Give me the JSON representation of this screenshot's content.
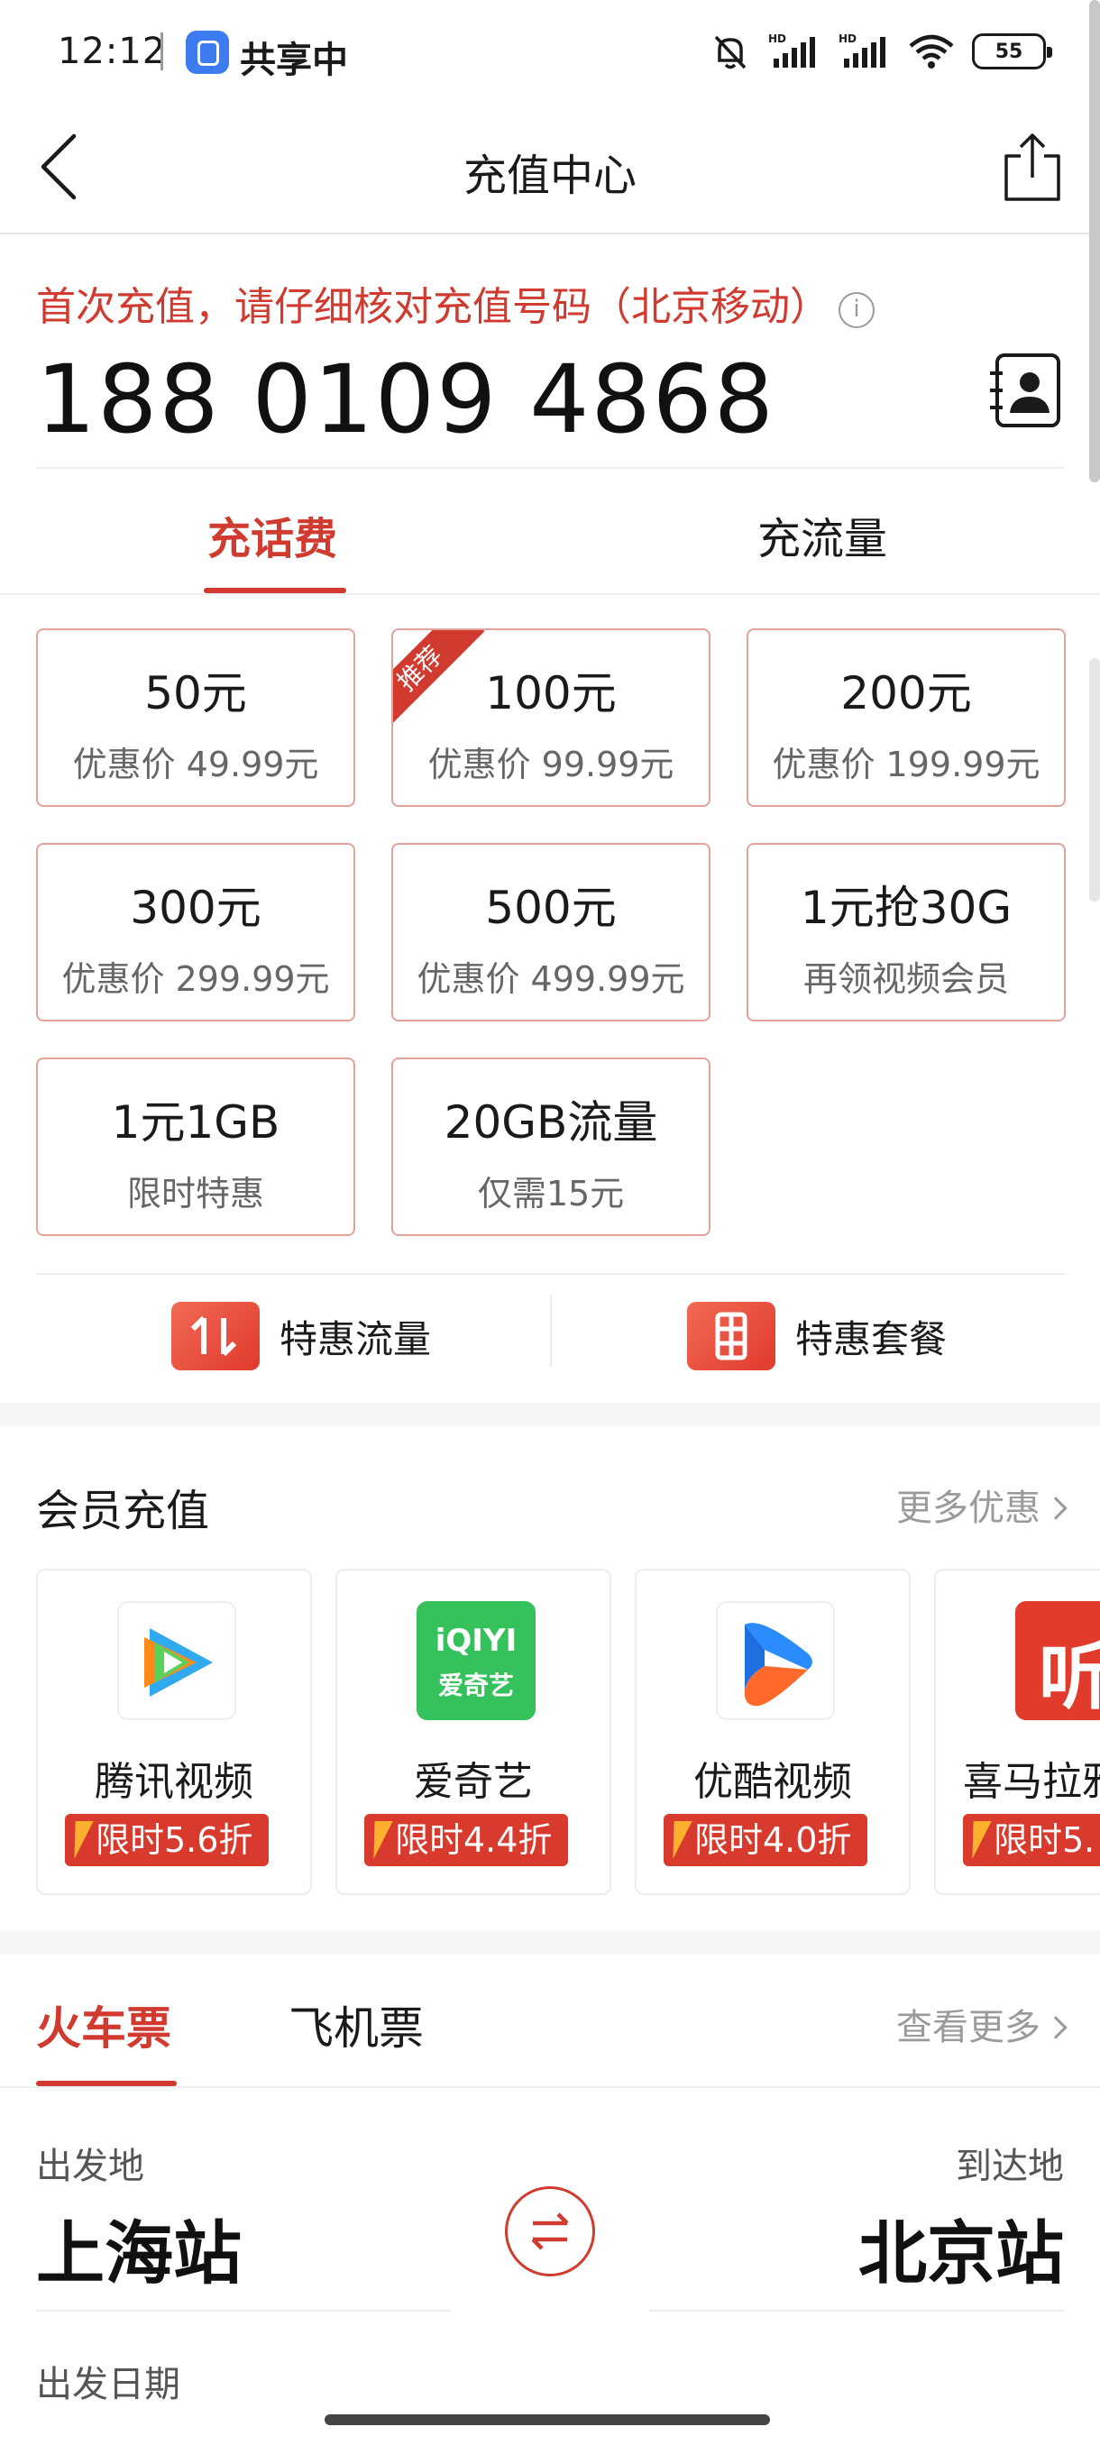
{
  "status_bar": {
    "time": "12:12",
    "share_text": "共享中",
    "battery": "55",
    "hd_label": "HD"
  },
  "nav": {
    "title": "充值中心"
  },
  "phone": {
    "notice": "首次充值，请仔细核对充值号码（北京移动）",
    "number": "188 0109 4868"
  },
  "tabs": {
    "active": "充话费",
    "inactive": "充流量"
  },
  "recharge_options": [
    {
      "main": "50元",
      "sub": "优惠价 49.99元"
    },
    {
      "main": "100元",
      "sub": "优惠价 99.99元",
      "tag": "推荐"
    },
    {
      "main": "200元",
      "sub": "优惠价 199.99元"
    },
    {
      "main": "300元",
      "sub": "优惠价 299.99元"
    },
    {
      "main": "500元",
      "sub": "优惠价 499.99元"
    },
    {
      "main": "1元抢30G",
      "sub": "再领视频会员"
    },
    {
      "main": "1元1GB",
      "sub": "限时特惠"
    },
    {
      "main": "20GB流量",
      "sub": "仅需15元"
    }
  ],
  "specials": {
    "flow": "特惠流量",
    "package": "特惠套餐"
  },
  "membership": {
    "title": "会员充值",
    "more": "更多优惠",
    "items": [
      {
        "name": "腾讯视频",
        "badge": "限时5.6折"
      },
      {
        "name": "爱奇艺",
        "badge": "限时4.4折",
        "logo_text": "iQIYI",
        "logo_sub": "爱奇艺"
      },
      {
        "name": "优酷视频",
        "badge": "限时4.0折"
      },
      {
        "name": "喜马拉雅",
        "badge": "限时5.",
        "logo_text": "听"
      }
    ]
  },
  "tickets": {
    "tab_train": "火车票",
    "tab_flight": "飞机票",
    "more": "查看更多",
    "from_label": "出发地",
    "to_label": "到达地",
    "from_station": "上海站",
    "to_station": "北京站",
    "date_label": "出发日期"
  },
  "colors": {
    "accent": "#d03a2f",
    "card_border": "#e4a29c",
    "muted": "#9a9a9a"
  }
}
